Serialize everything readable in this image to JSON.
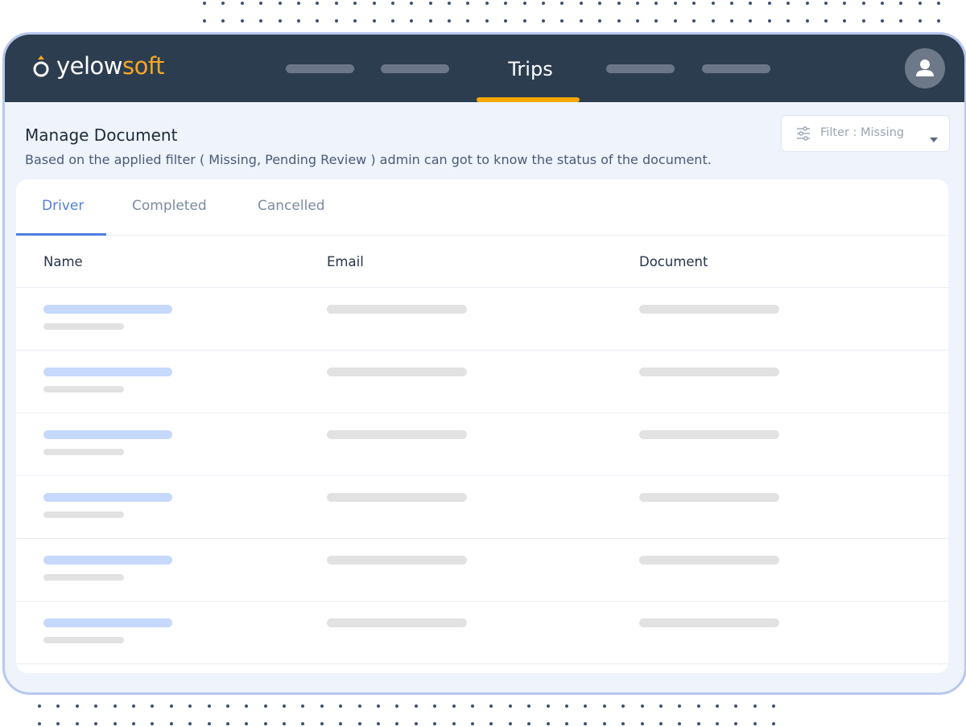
{
  "brand": {
    "name_part1": "yelow",
    "name_part2": "soft",
    "accent": "#f5a623",
    "icon": "logo-mark-icon"
  },
  "nav": {
    "active_label": "Trips"
  },
  "header": {
    "title": "Manage Document",
    "subtitle": "Based on the applied filter ( Missing, Pending Review ) admin can got to know the status of the document."
  },
  "filter": {
    "label": "Filter : Missing"
  },
  "tabs": [
    {
      "label": "Driver"
    },
    {
      "label": "Completed"
    },
    {
      "label": "Cancelled"
    }
  ],
  "table": {
    "columns": [
      "Name",
      "Email",
      "Document"
    ]
  },
  "colors": {
    "topbar": "#2d3d50",
    "accent_tab": "#4e7fe0",
    "active_underline": "#f5a800"
  }
}
